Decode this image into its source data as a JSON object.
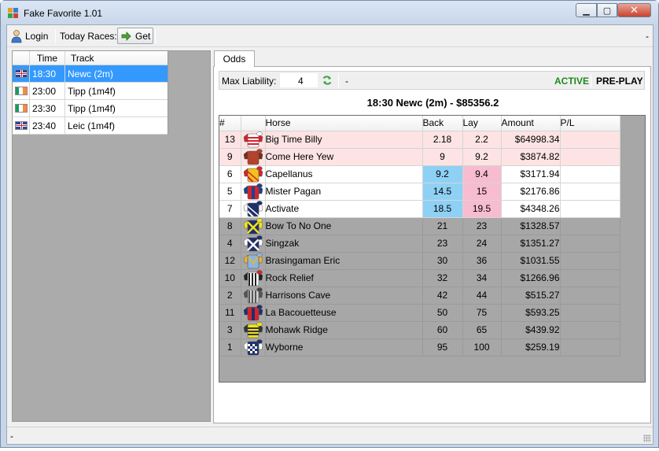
{
  "window": {
    "title": "Fake Favorite 1.01",
    "close_glyph": "✕",
    "min_glyph": "▁",
    "max_glyph": "▢"
  },
  "toolbar": {
    "login_label": "Login",
    "today_races_label": "Today Races:",
    "get_label": "Get",
    "right_dash": "-"
  },
  "races": {
    "columns": [
      "Time",
      "Track"
    ],
    "rows": [
      {
        "flag": "gb",
        "time": "18:30",
        "track": "Newc  (2m)",
        "selected": true
      },
      {
        "flag": "ie",
        "time": "23:00",
        "track": "Tipp  (1m4f)",
        "selected": false
      },
      {
        "flag": "ie",
        "time": "23:30",
        "track": "Tipp  (1m4f)",
        "selected": false
      },
      {
        "flag": "gb",
        "time": "23:40",
        "track": "Leic  (1m4f)",
        "selected": false
      }
    ]
  },
  "odds_tab": {
    "tab_label": "Odds",
    "max_liability_label": "Max Liability:",
    "max_liability_value": "4",
    "separator_dash": "-",
    "status_active": "ACTIVE",
    "status_preplay": "PRE-PLAY",
    "race_title": "18:30 Newc  (2m) - $85356.2",
    "columns": [
      "#",
      "",
      "Horse",
      "Back",
      "Lay",
      "Amount",
      "P/L"
    ],
    "runners": [
      {
        "num": "13",
        "horse": "Big Time Billy",
        "back": "2.18",
        "lay": "2.2",
        "amount": "$64998.34",
        "pl": "",
        "style": "fav",
        "back_hl": false,
        "lay_hl": false,
        "silk": "red-white-hoops"
      },
      {
        "num": "9",
        "horse": "Come Here Yew",
        "back": "9",
        "lay": "9.2",
        "amount": "$3874.82",
        "pl": "",
        "style": "fav",
        "back_hl": false,
        "lay_hl": false,
        "silk": "brown"
      },
      {
        "num": "6",
        "horse": "Capellanus",
        "back": "9.2",
        "lay": "9.4",
        "amount": "$3171.94",
        "pl": "",
        "style": "live",
        "back_hl": true,
        "lay_hl": true,
        "silk": "yellow-red"
      },
      {
        "num": "5",
        "horse": "Mister Pagan",
        "back": "14.5",
        "lay": "15",
        "amount": "$2176.86",
        "pl": "",
        "style": "live",
        "back_hl": true,
        "lay_hl": true,
        "silk": "red-blue"
      },
      {
        "num": "7",
        "horse": "Activate",
        "back": "18.5",
        "lay": "19.5",
        "amount": "$4348.26",
        "pl": "",
        "style": "live",
        "back_hl": true,
        "lay_hl": true,
        "silk": "navy-white"
      },
      {
        "num": "8",
        "horse": "Bow To No One",
        "back": "21",
        "lay": "23",
        "amount": "$1328.57",
        "pl": "",
        "style": "gray",
        "back_hl": false,
        "lay_hl": false,
        "silk": "navy-yellow"
      },
      {
        "num": "4",
        "horse": "Singzak",
        "back": "23",
        "lay": "24",
        "amount": "$1351.27",
        "pl": "",
        "style": "gray",
        "back_hl": false,
        "lay_hl": false,
        "silk": "navy-cross"
      },
      {
        "num": "12",
        "horse": "Brasingaman Eric",
        "back": "30",
        "lay": "36",
        "amount": "$1031.55",
        "pl": "",
        "style": "gray",
        "back_hl": false,
        "lay_hl": false,
        "silk": "lightblue"
      },
      {
        "num": "10",
        "horse": "Rock Relief",
        "back": "32",
        "lay": "34",
        "amount": "$1266.96",
        "pl": "",
        "style": "gray",
        "back_hl": false,
        "lay_hl": false,
        "silk": "black-white-stripes"
      },
      {
        "num": "2",
        "horse": "Harrisons Cave",
        "back": "42",
        "lay": "44",
        "amount": "$515.27",
        "pl": "",
        "style": "gray",
        "back_hl": false,
        "lay_hl": false,
        "silk": "grey-stripes"
      },
      {
        "num": "11",
        "horse": "La Bacouetteuse",
        "back": "50",
        "lay": "75",
        "amount": "$593.25",
        "pl": "",
        "style": "gray",
        "back_hl": false,
        "lay_hl": false,
        "silk": "red-navy"
      },
      {
        "num": "3",
        "horse": "Mohawk Ridge",
        "back": "60",
        "lay": "65",
        "amount": "$439.92",
        "pl": "",
        "style": "gray",
        "back_hl": false,
        "lay_hl": false,
        "silk": "yellow-hoops"
      },
      {
        "num": "1",
        "horse": "Wyborne",
        "back": "95",
        "lay": "100",
        "amount": "$259.19",
        "pl": "",
        "style": "gray",
        "back_hl": false,
        "lay_hl": false,
        "silk": "navy-check"
      }
    ]
  },
  "statusbar": {
    "text": "-"
  },
  "colors": {
    "selected_row": "#3399ff",
    "favorite_row": "#fde3e3",
    "back_highlight": "#8fd0f5",
    "lay_highlight": "#f8bcd0",
    "active_status": "#1e8a1e"
  }
}
